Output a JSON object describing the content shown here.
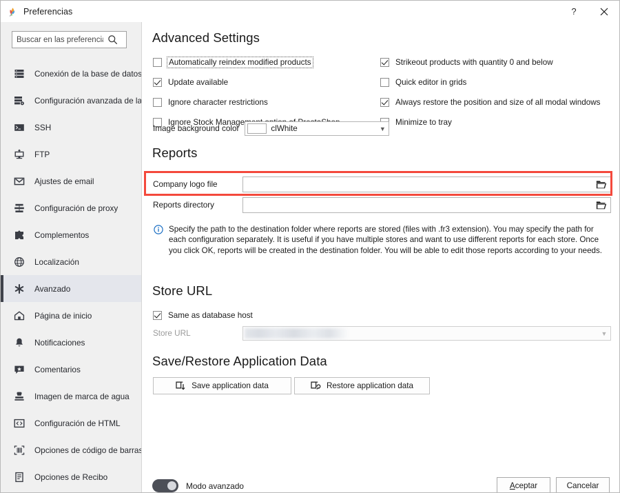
{
  "window": {
    "title": "Preferencias",
    "app_icon": "leaf-icon",
    "help_label": "?",
    "close_label": "✕"
  },
  "sidebar": {
    "search": {
      "placeholder": "Buscar en las preferencias",
      "value": "",
      "icon": "search-icon"
    },
    "items": [
      {
        "label": "Conexión de la base de datos",
        "icon": "database-icon",
        "key": "database-connection",
        "selected": false
      },
      {
        "label": "Configuración avanzada de la …",
        "icon": "database-settings-icon",
        "key": "advanced-database-settings",
        "selected": false
      },
      {
        "label": "SSH",
        "icon": "terminal-icon",
        "key": "ssh",
        "selected": false
      },
      {
        "label": "FTP",
        "icon": "ftp-icon",
        "key": "ftp",
        "selected": false
      },
      {
        "label": "Ajustes de email",
        "icon": "envelope-icon",
        "key": "email-settings",
        "selected": false
      },
      {
        "label": "Configuración de proxy",
        "icon": "proxy-icon",
        "key": "proxy-settings",
        "selected": false
      },
      {
        "label": "Complementos",
        "icon": "puzzle-icon",
        "key": "plugins",
        "selected": false
      },
      {
        "label": "Localización",
        "icon": "globe-icon",
        "key": "localization",
        "selected": false
      },
      {
        "label": "Avanzado",
        "icon": "asterisk-icon",
        "key": "advanced",
        "selected": true
      },
      {
        "label": "Página de inicio",
        "icon": "home-icon",
        "key": "home-page",
        "selected": false
      },
      {
        "label": "Notificaciones",
        "icon": "bell-icon",
        "key": "notifications",
        "selected": false
      },
      {
        "label": "Comentarios",
        "icon": "feedback-icon",
        "key": "comments",
        "selected": false
      },
      {
        "label": "Imagen de marca de agua",
        "icon": "stamp-icon",
        "key": "watermark-image",
        "selected": false
      },
      {
        "label": "Configuración de HTML",
        "icon": "code-icon",
        "key": "html-settings",
        "selected": false
      },
      {
        "label": "Opciones de código de barras",
        "icon": "barcode-icon",
        "key": "barcode-options",
        "selected": false
      },
      {
        "label": "Opciones de Recibo",
        "icon": "receipt-icon",
        "key": "receipt-options",
        "selected": false
      }
    ]
  },
  "advanced": {
    "heading": "Advanced Settings",
    "checkboxes_left": [
      {
        "label": "Automatically reindex modified products",
        "checked": false,
        "focused": true
      },
      {
        "label": "Update available",
        "checked": true,
        "focused": false
      },
      {
        "label": "Ignore character restrictions",
        "checked": false,
        "focused": false
      },
      {
        "label": "Ignore Stock Management option of PrestaShop",
        "checked": false,
        "focused": false
      }
    ],
    "checkboxes_right": [
      {
        "label": "Strikeout products with quantity 0 and below",
        "checked": true
      },
      {
        "label": "Quick editor in grids",
        "checked": false
      },
      {
        "label": "Always restore the position and size of all modal windows",
        "checked": true
      },
      {
        "label": "Minimize to tray",
        "checked": false
      }
    ],
    "image_bg": {
      "label": "Image background color",
      "value": "clWhite",
      "swatch": "#ffffff",
      "arrow_icon": "chevron-down-icon"
    }
  },
  "reports": {
    "heading": "Reports",
    "fields": [
      {
        "label": "Company logo file",
        "value": "",
        "browse_icon": "folder-open-icon",
        "highlighted": true
      },
      {
        "label": "Reports directory",
        "value": "",
        "browse_icon": "folder-open-icon",
        "highlighted": false
      }
    ],
    "info_icon": "info-icon",
    "info_text": "Specify the path to the destination folder where reports are stored (files with .fr3 extension). You may specify the path for each configuration separately. It is useful if you have multiple stores and want to use different reports for each store. Once you click OK, reports will be created in the destination folder. You will be able to edit those reports according to your needs."
  },
  "store_url": {
    "heading": "Store URL",
    "same_as_host": {
      "label": "Same as database host",
      "checked": true
    },
    "field": {
      "label": "Store URL",
      "value": "",
      "redacted": true,
      "disabled": true,
      "arrow_icon": "chevron-down-icon"
    }
  },
  "save_restore": {
    "heading": "Save/Restore Application Data",
    "save_label": "Save application data",
    "save_icon": "save-data-icon",
    "restore_label": "Restore application data",
    "restore_icon": "restore-data-icon"
  },
  "footer": {
    "advanced_mode_label": "Modo avanzado",
    "advanced_mode_on": true,
    "accept_label": "Aceptar",
    "accept_accel": "A",
    "cancel_label": "Cancelar"
  },
  "colors": {
    "highlight": "#f4493c",
    "sidebar_bg": "#f0f0f0",
    "selected_item_bg": "#e4e6ec",
    "selected_accent": "#3f424b",
    "info_blue": "#1b6fc4"
  }
}
